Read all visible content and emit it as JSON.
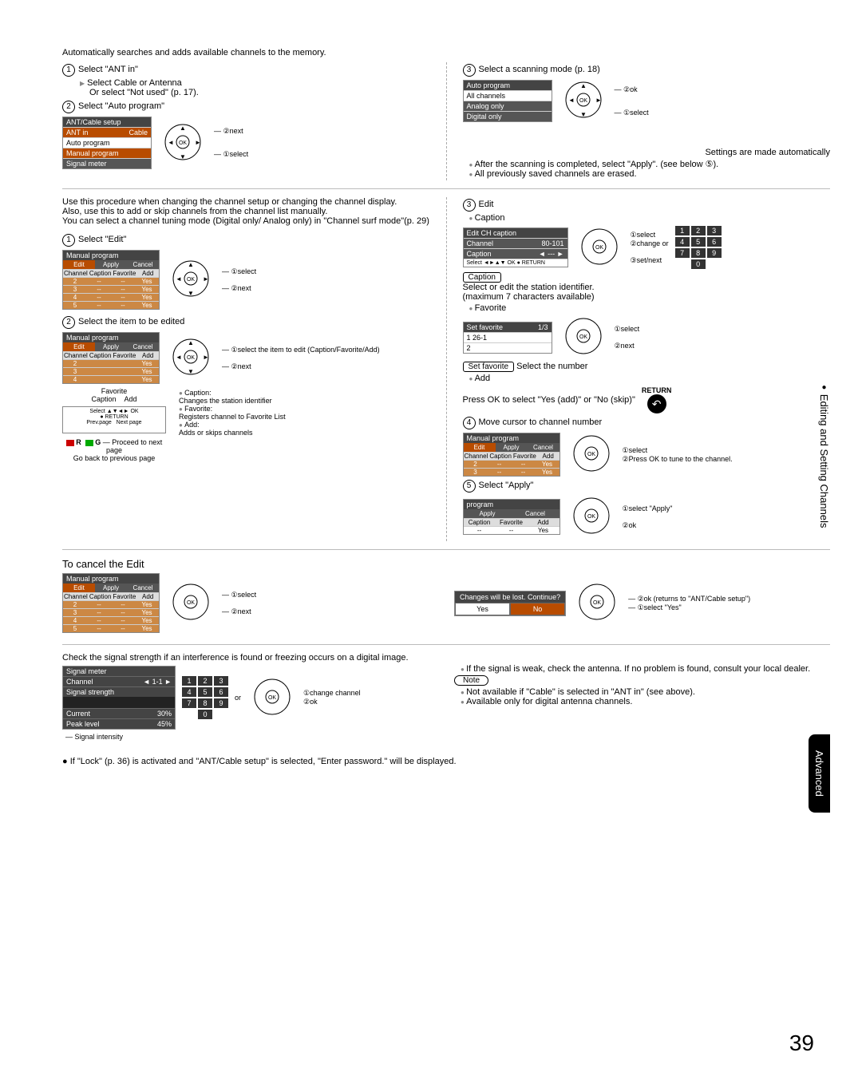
{
  "page_number": "39",
  "side_tab_editing": "Editing and Setting Channels",
  "side_tab_advanced": "Advanced",
  "intro": "Automatically searches and adds available channels to the memory.",
  "s1": {
    "title": "Select \"ANT in\"",
    "sub1": "Select Cable or Antenna",
    "sub2": "Or select \"Not used\" (p. 17)."
  },
  "s2": {
    "title": "Select \"Auto program\""
  },
  "s3": {
    "title": "Select a scanning mode (p. 18)"
  },
  "menu_ant": {
    "title": "ANT/Cable setup",
    "r1a": "ANT in",
    "r1b": "Cable",
    "r2": "Auto program",
    "r3": "Manual program",
    "r4": "Signal meter"
  },
  "menu_auto": {
    "title": "Auto program",
    "r1": "All channels",
    "r2": "Analog only",
    "r3": "Digital only"
  },
  "nav": {
    "next": "next",
    "select": "select",
    "ok": "ok",
    "change": "change or",
    "setnext": "set/next"
  },
  "after_scan": {
    "auto": "Settings are made automatically",
    "b1": "After the scanning is completed, select \"Apply\". (see below ⑤).",
    "b2": "All previously saved channels are erased."
  },
  "manual_intro": {
    "l1": "Use this procedure when changing the channel setup or changing the channel display.",
    "l2": "Also, use this to add or skip channels from the channel list manually.",
    "l3": "You can select a channel tuning mode (Digital only/ Analog only) in \"Channel surf mode\"(p. 29)"
  },
  "m1": {
    "title": "Select \"Edit\""
  },
  "m2": {
    "title": "Select the item to be edited",
    "label1": "select the item to edit (Caption/Favorite/Add)",
    "label2": "next"
  },
  "tbl": {
    "title": "Manual program",
    "h1": "Edit",
    "h2": "Apply",
    "h3": "Cancel",
    "c1": "Channel",
    "c2": "Caption",
    "c3": "Favorite",
    "c4": "Add",
    "yes": "Yes"
  },
  "fav_cap": {
    "fav": "Favorite",
    "cap": "Caption",
    "add": "Add"
  },
  "explain": {
    "caption": "Caption:",
    "caption_d": "Changes the station identifier",
    "favorite": "Favorite:",
    "favorite_d": "Registers channel to Favorite List",
    "add": "Add:",
    "add_d": "Adds or skips channels"
  },
  "rg": {
    "r": "R",
    "g": "G",
    "proceed": "Proceed to next page",
    "goback": "Go back to previous page"
  },
  "e3": {
    "title": "Edit",
    "caption": "Caption"
  },
  "editch": {
    "title": "Edit CH caption",
    "channel": "Channel",
    "chval": "80-101",
    "caption": "Caption",
    "dash": "---"
  },
  "caption_pill": "Caption",
  "caption_desc1": "Select or edit the station identifier.",
  "caption_desc2": "(maximum 7 characters available)",
  "favorite_label": "Favorite",
  "setfav": {
    "title": "Set favorite",
    "count": "1/3",
    "r1": "1   26-1",
    "r2": "2"
  },
  "setfav_pill": "Set favorite",
  "setfav_desc": "Select the number",
  "add_label": "Add",
  "add_desc": "Press OK to select \"Yes (add)\" or \"No (skip)\"",
  "return_label": "RETURN",
  "e4": {
    "title": "Move cursor to channel number",
    "press": "Press OK to tune to the channel."
  },
  "e5": {
    "title": "Select \"Apply\"",
    "sel_apply": "select \"Apply\"",
    "ok": "ok"
  },
  "cancel": {
    "title": "To cancel the Edit",
    "confirm": "Changes will be lost. Continue?",
    "yes": "Yes",
    "no": "No",
    "ok_returns": "ok (returns to \"ANT/Cable setup\")",
    "select_yes": "select \"Yes\""
  },
  "signal": {
    "intro": "Check the signal strength if an interference is found or freezing occurs on a digital image.",
    "title": "Signal meter",
    "channel": "Channel",
    "chval": "1-1",
    "strength": "Signal strength",
    "current": "Current",
    "curval": "30%",
    "peak": "Peak level",
    "peakval": "45%",
    "intensity": "Signal intensity",
    "or": "or",
    "change": "change channel",
    "ok": "ok",
    "b1": "If the signal is weak, check the antenna. If no problem is found, consult your local dealer.",
    "note": "Note",
    "b2": "Not available if \"Cable\" is selected in \"ANT in\" (see above).",
    "b3": "Available only for digital antenna channels."
  },
  "footnote": "If \"Lock\" (p. 36) is activated and \"ANT/Cable setup\" is selected, \"Enter password.\" will be displayed.",
  "keypad": [
    "1",
    "2",
    "3",
    "4",
    "5",
    "6",
    "7",
    "8",
    "9",
    "0"
  ]
}
